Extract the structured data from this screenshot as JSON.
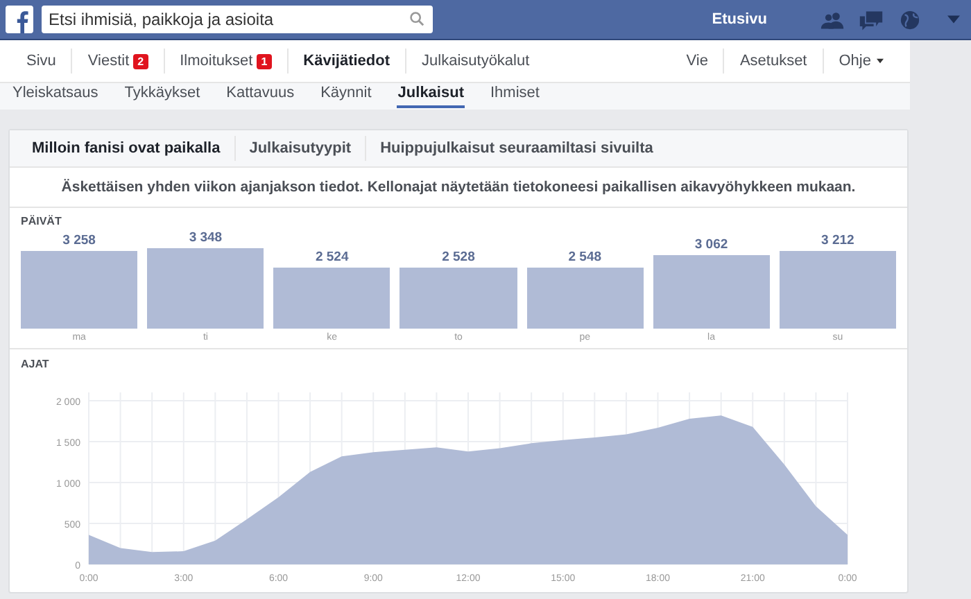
{
  "top_bar": {
    "search": {
      "placeholder": "Etsi ihmisiä, paikkoja ja asioita"
    },
    "home_link": "Etusivu"
  },
  "page_nav": {
    "left": [
      {
        "label": "Sivu",
        "selected": false
      },
      {
        "label": "Viestit",
        "badge": "2",
        "selected": false
      },
      {
        "label": "Ilmoitukset",
        "badge": "1",
        "selected": false
      },
      {
        "label": "Kävijätiedot",
        "selected": true
      },
      {
        "label": "Julkaisutyökalut",
        "selected": false
      }
    ],
    "right": [
      {
        "label": "Vie",
        "dropdown": false
      },
      {
        "label": "Asetukset",
        "dropdown": false
      },
      {
        "label": "Ohje",
        "dropdown": true
      }
    ]
  },
  "sub_nav": [
    {
      "label": "Yleiskatsaus",
      "selected": false
    },
    {
      "label": "Tykkäykset",
      "selected": false
    },
    {
      "label": "Kattavuus",
      "selected": false
    },
    {
      "label": "Käynnit",
      "selected": false
    },
    {
      "label": "Julkaisut",
      "selected": true
    },
    {
      "label": "Ihmiset",
      "selected": false
    }
  ],
  "card": {
    "tabs": [
      {
        "label": "Milloin fanisi ovat paikalla",
        "selected": true
      },
      {
        "label": "Julkaisutyypit",
        "selected": false
      },
      {
        "label": "Huippujulkaisut seuraamiltasi sivuilta",
        "selected": false
      }
    ],
    "note": "Äskettäisen yhden viikon ajanjakson tiedot. Kellonajat näytetään tietokoneesi paikallisen aikavyöhykkeen mukaan.",
    "days": {
      "heading": "PÄIVÄT",
      "chart_data": {
        "type": "bar",
        "categories": [
          "ma",
          "ti",
          "ke",
          "to",
          "pe",
          "la",
          "su"
        ],
        "values": [
          3258,
          3348,
          2524,
          2528,
          2548,
          3062,
          3212
        ],
        "value_labels": [
          "3 258",
          "3 348",
          "2 524",
          "2 528",
          "2 548",
          "3 062",
          "3 212"
        ]
      }
    },
    "times": {
      "heading": "AJAT",
      "chart_data": {
        "type": "area",
        "x": [
          0,
          1,
          2,
          3,
          4,
          5,
          6,
          7,
          8,
          9,
          10,
          11,
          12,
          13,
          14,
          15,
          16,
          17,
          18,
          19,
          20,
          21,
          22,
          23,
          24
        ],
        "values": [
          360,
          200,
          150,
          160,
          290,
          550,
          820,
          1130,
          1320,
          1370,
          1400,
          1430,
          1380,
          1420,
          1480,
          1520,
          1550,
          1590,
          1670,
          1780,
          1820,
          1680,
          1220,
          710,
          360
        ],
        "xlim": [
          0,
          24
        ],
        "ylim": [
          0,
          2000
        ],
        "grid": true,
        "xticks": [
          {
            "value": 0,
            "label": "0:00"
          },
          {
            "value": 3,
            "label": "3:00"
          },
          {
            "value": 6,
            "label": "6:00"
          },
          {
            "value": 9,
            "label": "9:00"
          },
          {
            "value": 12,
            "label": "12:00"
          },
          {
            "value": 15,
            "label": "15:00"
          },
          {
            "value": 18,
            "label": "18:00"
          },
          {
            "value": 21,
            "label": "21:00"
          },
          {
            "value": 24,
            "label": "0:00"
          }
        ],
        "yticks": [
          {
            "value": 0,
            "label": "0"
          },
          {
            "value": 500,
            "label": "500"
          },
          {
            "value": 1000,
            "label": "1 000"
          },
          {
            "value": 1500,
            "label": "1 500"
          },
          {
            "value": 2000,
            "label": "2 000"
          }
        ]
      }
    }
  }
}
